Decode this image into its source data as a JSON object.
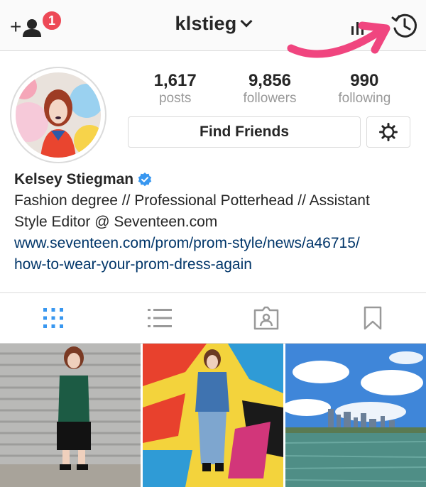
{
  "header": {
    "username": "klstieg",
    "notification_count": "1",
    "icons": [
      "add-person-icon",
      "chevron-down-icon",
      "insights-icon",
      "history-icon"
    ]
  },
  "profile": {
    "stats": [
      {
        "value": "1,617",
        "label": "posts"
      },
      {
        "value": "9,856",
        "label": "followers"
      },
      {
        "value": "990",
        "label": "following"
      }
    ],
    "find_friends_label": "Find Friends",
    "name": "Kelsey Stiegman",
    "verified": true,
    "bio_line1": "Fashion degree // Professional Potterhead // Assistant",
    "bio_line2": "Style Editor @ Seventeen.com",
    "link_line1": "www.seventeen.com/prom/prom-style/news/a46715/",
    "link_line2": "how-to-wear-your-prom-dress-again"
  },
  "tabs": [
    {
      "icon": "grid-icon",
      "active": true
    },
    {
      "icon": "list-icon",
      "active": false
    },
    {
      "icon": "tagged-icon",
      "active": false
    },
    {
      "icon": "bookmark-icon",
      "active": false
    }
  ],
  "colors": {
    "accent_blue": "#3897f0",
    "badge_red": "#ed4956",
    "link": "#003569",
    "annotation_arrow": "#f0457f"
  }
}
